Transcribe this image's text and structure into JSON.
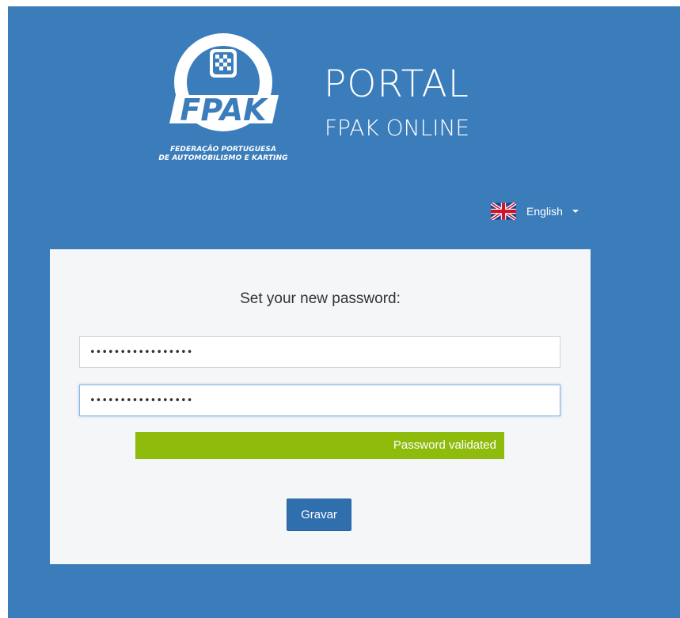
{
  "header": {
    "logo_text": "FPAK",
    "logo_caption_line1": "FEDERAÇÃO PORTUGUESA",
    "logo_caption_line2": "DE AUTOMOBILISMO E KARTING",
    "portal_title": "PORTAL",
    "portal_subtitle": "FPAK ONLINE"
  },
  "language": {
    "label": "English",
    "flag_icon": "uk-flag-icon"
  },
  "form": {
    "title": "Set your new password:",
    "password_value": "•••••••••••••••••",
    "confirm_value": "•••••••••••••••••",
    "strength_text": "Password validated",
    "save_label": "Gravar"
  },
  "colors": {
    "background": "#3b7dbb",
    "panel": "#f4f6f7",
    "validated": "#8fbb0c",
    "button": "#2f6fae"
  }
}
